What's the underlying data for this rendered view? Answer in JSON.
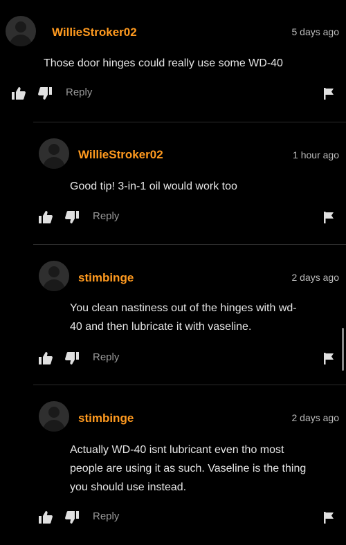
{
  "comments": [
    {
      "username": "WillieStroker02",
      "time": "5 days ago",
      "lines": [
        "Those door hinges could really use some WD-40"
      ],
      "reply_label": "Reply"
    },
    {
      "username": "WillieStroker02",
      "time": "1 hour ago",
      "lines": [
        "Good tip! 3-in-1 oil would work too"
      ],
      "reply_label": "Reply"
    },
    {
      "username": "stimbinge",
      "time": "2 days ago",
      "lines": [
        "You clean nastiness out of the hinges with wd-",
        "40 and then lubricate it with vaseline."
      ],
      "reply_label": "Reply"
    },
    {
      "username": "stimbinge",
      "time": "2 days ago",
      "lines": [
        "Actually WD-40 isnt lubricant even tho most",
        "people are using it as such. Vaseline is the thing",
        "you should use instead."
      ],
      "reply_label": "Reply"
    }
  ],
  "icons": {
    "like": "thumbs-up-icon",
    "dislike": "thumbs-down-icon",
    "flag": "flag-icon",
    "avatar": "default-avatar-icon"
  },
  "colors": {
    "background": "#000000",
    "username": "#ff9a1f",
    "text": "#e6e6e6",
    "meta": "#bcbcbc",
    "reply": "#9a9a9a",
    "divider": "#2c2c2c"
  }
}
